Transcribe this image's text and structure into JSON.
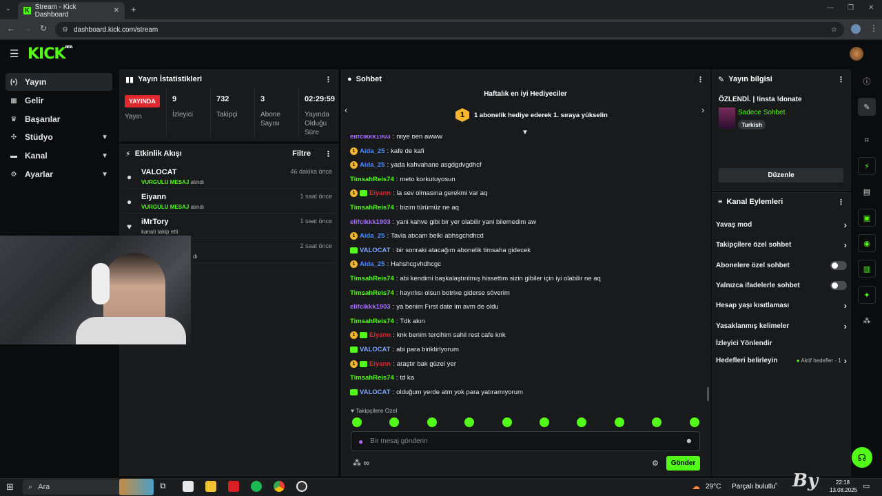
{
  "browser": {
    "tab_title": "Stream - Kick Dashboard",
    "url": "dashboard.kick.com/stream"
  },
  "logo": {
    "text": "KICK",
    "badge": "BETA"
  },
  "nav": [
    {
      "label": "Yayın",
      "icon": "broadcast-icon"
    },
    {
      "label": "Gelir",
      "icon": "revenue-icon"
    },
    {
      "label": "Başarılar",
      "icon": "trophy-icon"
    },
    {
      "label": "Stüdyo",
      "icon": "studio-icon"
    },
    {
      "label": "Kanal",
      "icon": "channel-icon"
    },
    {
      "label": "Ayarlar",
      "icon": "settings-icon"
    }
  ],
  "stats": {
    "title": "Yayın İstatistikleri",
    "live": "YAYINDA",
    "live_label": "Yayın",
    "viewers": "9",
    "viewers_label": "İzleyici",
    "followers": "732",
    "followers_label": "Takipçi",
    "subs": "3",
    "subs_label": "Abone Sayısı",
    "uptime": "02:29:59",
    "uptime_label": "Yayında Olduğu Süre"
  },
  "activity": {
    "title": "Etkinlik Akışı",
    "filter": "Filtre",
    "items": [
      {
        "name": "VALOCAT",
        "desc_strong": "VURGULU MESAJ",
        "desc": "alındı",
        "time": "46 dakika önce"
      },
      {
        "name": "Eiyann",
        "desc_strong": "VURGULU MESAJ",
        "desc": "alındı",
        "time": "1 saat önce"
      },
      {
        "name": "iMrTory",
        "desc_strong": "",
        "desc": "kanalı takip etti",
        "time": "1 saat önce"
      },
      {
        "name": "",
        "desc_strong": "",
        "desc": "dı",
        "time": "2 saat önce"
      }
    ]
  },
  "chat": {
    "title": "Sohbet",
    "banner_title": "Haftalık en iyi Hediyeciler",
    "banner_rank": "1",
    "banner_text": "1 abonelik hediye ederek 1. sıraya yükselin",
    "messages": [
      {
        "user": "elifcikkk1903",
        "color": "#a970ff",
        "b1": false,
        "b2": false,
        "text": "hiiye ben awww"
      },
      {
        "user": "Aida_25",
        "color": "#4a8cff",
        "b1": true,
        "b2": false,
        "text": "kafe de kafi"
      },
      {
        "user": "Aida_25",
        "color": "#4a8cff",
        "b1": true,
        "b2": false,
        "text": "yada kahvahane asgdgdvgdhcf"
      },
      {
        "user": "TimsahReis74",
        "color": "#53fc18",
        "b1": false,
        "b2": false,
        "text": "meto korkutuyosun"
      },
      {
        "user": "Eiyann",
        "color": "#e0292f",
        "b1": true,
        "b2": true,
        "text": "la sev olmasına gerekmi var aq"
      },
      {
        "user": "TimsahReis74",
        "color": "#53fc18",
        "b1": false,
        "b2": false,
        "text": "bizim türümüz ne aq"
      },
      {
        "user": "elifcikkk1903",
        "color": "#a970ff",
        "b1": false,
        "b2": false,
        "text": "yani kahve gibi bir yer olabilir yani bilemedim aw"
      },
      {
        "user": "Aida_25",
        "color": "#4a8cff",
        "b1": true,
        "b2": false,
        "text": "Tavla atıcam belki abhsgchdhcd"
      },
      {
        "user": "VALOCAT",
        "color": "#7fa8ff",
        "b1": false,
        "b2": true,
        "text": "bir sonraki atacağım abonelik timsaha gidecek"
      },
      {
        "user": "Aida_25",
        "color": "#4a8cff",
        "b1": true,
        "b2": false,
        "text": "Hahshcgvhdhcgc"
      },
      {
        "user": "TimsahReis74",
        "color": "#53fc18",
        "b1": false,
        "b2": false,
        "text": "abi kendimi başkalaştırılmış hissettim sizin gibiler için iyi olabilir ne aq"
      },
      {
        "user": "TimsahReis74",
        "color": "#53fc18",
        "b1": false,
        "b2": false,
        "text": "hayırlısı olsun botrixe giderse söverim"
      },
      {
        "user": "elifcikkk1903",
        "color": "#a970ff",
        "b1": false,
        "b2": false,
        "text": "ya benim Fırst date im avm de oldu"
      },
      {
        "user": "TimsahReis74",
        "color": "#53fc18",
        "b1": false,
        "b2": false,
        "text": "Tdk akın"
      },
      {
        "user": "Eiyann",
        "color": "#e0292f",
        "b1": true,
        "b2": true,
        "text": "knk benim tercihim sahil rest cafe knk"
      },
      {
        "user": "VALOCAT",
        "color": "#7fa8ff",
        "b1": false,
        "b2": true,
        "text": "abi para biriktirlyorum"
      },
      {
        "user": "Eiyann",
        "color": "#e0292f",
        "b1": true,
        "b2": true,
        "text": "araştır bak güzel yer"
      },
      {
        "user": "TimsahReis74",
        "color": "#53fc18",
        "b1": false,
        "b2": false,
        "text": "td ka"
      },
      {
        "user": "VALOCAT",
        "color": "#7fa8ff",
        "b1": false,
        "b2": true,
        "text": "olduğum yerde atm yok para yatıramıyorum"
      }
    ],
    "followers_only": "Takipçilere Özel",
    "placeholder": "Bir mesaj gönderin",
    "send": "Gönder",
    "infinity": "∞"
  },
  "info": {
    "title": "Yayın bilgisi",
    "stream_title": "ÖZLENDİ. | !insta !donate",
    "category": "Sadece Sohbet",
    "tag": "Turkish",
    "edit": "Düzenle"
  },
  "actions": {
    "title": "Kanal Eylemleri",
    "items": [
      {
        "label": "Yavaş mod",
        "type": "arrow"
      },
      {
        "label": "Takipçilere özel sohbet",
        "type": "arrow"
      },
      {
        "label": "Abonelere özel sohbet",
        "type": "toggle"
      },
      {
        "label": "Yalnızca ifadelerle sohbet",
        "type": "toggle"
      },
      {
        "label": "Hesap yaşı kısıtlaması",
        "type": "arrow"
      },
      {
        "label": "Yasaklanmış kelimeler",
        "type": "arrow"
      },
      {
        "label": "İzleyici Yönlendir",
        "type": "none"
      },
      {
        "label": "Hedefleri belirleyin",
        "type": "goal",
        "extra": "Aktif hedefler - 1"
      }
    ]
  },
  "taskbar": {
    "search": "Ara",
    "weather": "29°C",
    "weather_desc": "Parçalı bulutlu",
    "time": "22:18",
    "date": "13.08.2025"
  },
  "colors": {
    "accent": "#53fc18",
    "live": "#e0292f",
    "panel": "#181a1b",
    "bg": "#0b0c0d"
  }
}
